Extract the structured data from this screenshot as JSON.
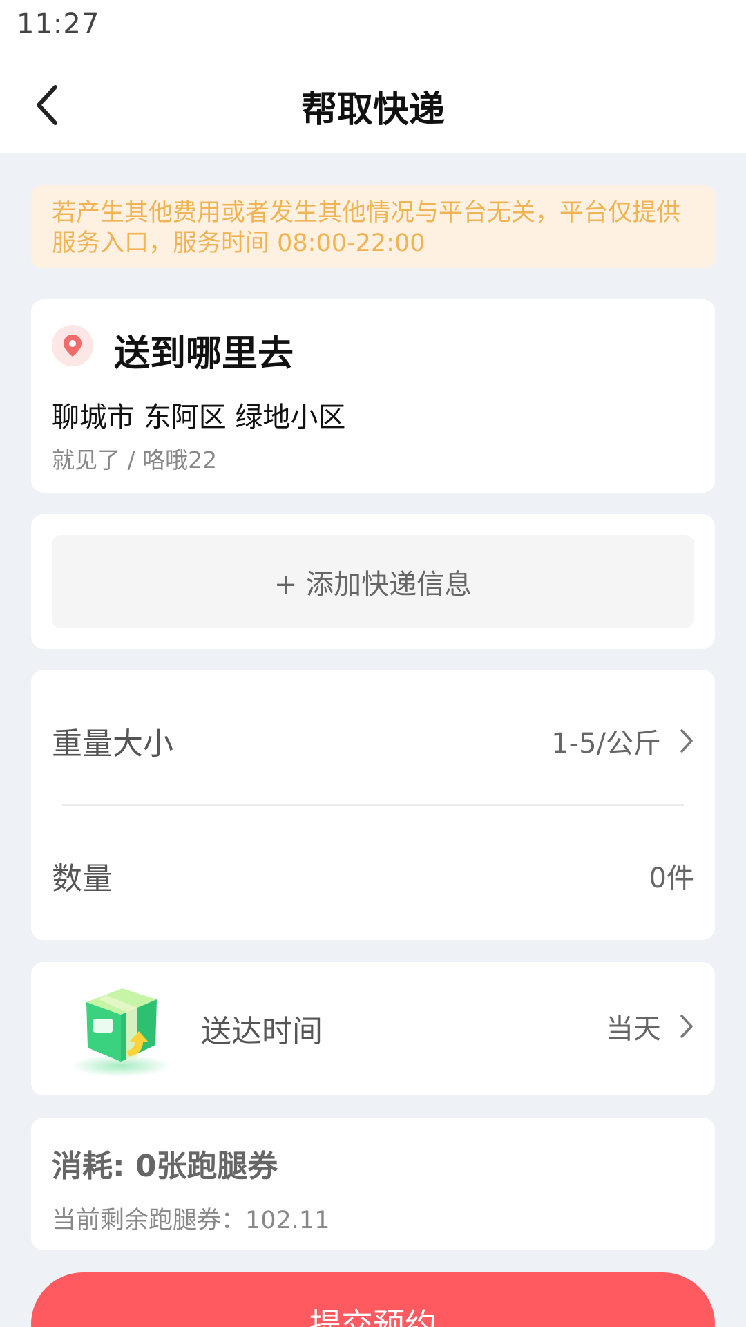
{
  "status_bar": {
    "time": "11:27"
  },
  "nav": {
    "title": "帮取快递",
    "back_icon": "chevron-left-icon"
  },
  "notice": {
    "text": "若产生其他费用或者发生其他情况与平台无关，平台仅提供服务入口，服务时间 08:00-22:00"
  },
  "destination": {
    "title": "送到哪里去",
    "icon": "location-pin-icon",
    "address": "聊城市 东阿区 绿地小区",
    "detail": "就见了 / 咯哦22"
  },
  "add_express": {
    "label": "+ 添加快递信息"
  },
  "weight": {
    "label": "重量大小",
    "value": "1-5/公斤"
  },
  "quantity": {
    "label": "数量",
    "value": "0件"
  },
  "delivery_time": {
    "label": "送达时间",
    "value": "当天",
    "icon": "package-box-icon"
  },
  "cost": {
    "prefix": "消耗:",
    "amount": "0张跑腿券",
    "remaining": "当前剩余跑腿券：102.11"
  },
  "submit": {
    "label": "提交预约"
  },
  "colors": {
    "accent": "#ff5a60",
    "notice_bg": "#fff1e1",
    "notice_text": "#f0b454",
    "page_bg": "#eef2f6"
  }
}
